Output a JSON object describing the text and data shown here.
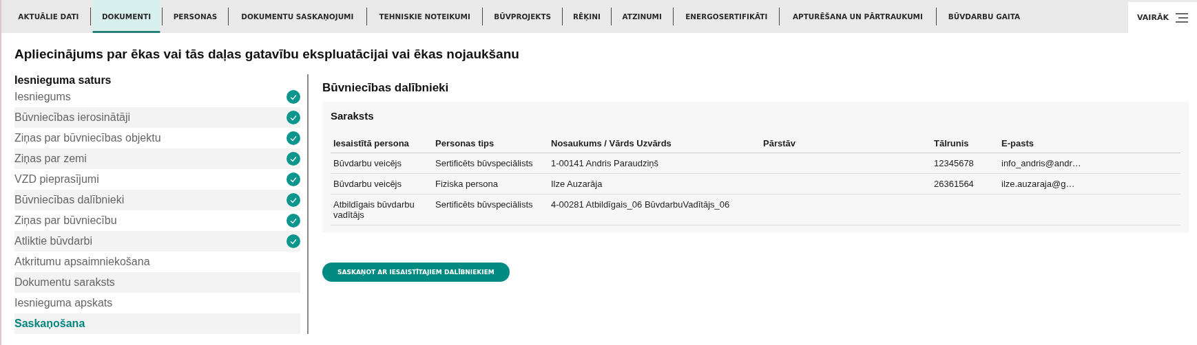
{
  "tabs": [
    {
      "label": "AKTUĀLIE DATI",
      "selected": false
    },
    {
      "label": "DOKUMENTI",
      "selected": true
    },
    {
      "label": "PERSONAS",
      "selected": false
    },
    {
      "label": "DOKUMENTU SASKAŅOJUMI",
      "selected": false
    },
    {
      "label": "TEHNISKIE NOTEIKUMI",
      "selected": false
    },
    {
      "label": "BŪVPROJEKTS",
      "selected": false
    },
    {
      "label": "RĒĶINI",
      "selected": false
    },
    {
      "label": "ATZINUMI",
      "selected": false
    },
    {
      "label": "ENERGOSERTIFIKĀTI",
      "selected": false
    },
    {
      "label": "APTURĒŠANA UN PĀRTRAUKUMI",
      "selected": false
    },
    {
      "label": "BŪVDARBU GAITA",
      "selected": false
    }
  ],
  "more_button": {
    "label": "VAIRĀK"
  },
  "page_title": "Apliecinājums par ēkas vai tās daļas gatavību ekspluatācijai vai ēkas nojaukšanu",
  "sidebar": {
    "heading": "Iesnieguma saturs",
    "items": [
      {
        "label": "Iesniegums",
        "checked": true,
        "selected": false
      },
      {
        "label": "Būvniecības ierosinātāji",
        "checked": true,
        "selected": false
      },
      {
        "label": "Ziņas par būvniecības objektu",
        "checked": true,
        "selected": false
      },
      {
        "label": "Ziņas par zemi",
        "checked": true,
        "selected": false
      },
      {
        "label": "VZD pieprasījumi",
        "checked": true,
        "selected": false
      },
      {
        "label": "Būvniecības dalībnieki",
        "checked": true,
        "selected": false
      },
      {
        "label": "Ziņas par būvniecību",
        "checked": true,
        "selected": false
      },
      {
        "label": "Atliktie būvdarbi",
        "checked": true,
        "selected": false
      },
      {
        "label": "Atkritumu apsaimniekošana",
        "checked": false,
        "selected": false
      },
      {
        "label": "Dokumentu saraksts",
        "checked": false,
        "selected": false
      },
      {
        "label": "Iesnieguma apskats",
        "checked": false,
        "selected": false
      },
      {
        "label": "Saskaņošana",
        "checked": false,
        "selected": true
      }
    ]
  },
  "section_title": "Būvniecības dalībnieki",
  "table": {
    "title": "Saraksts",
    "columns": [
      "Iesaistītā persona",
      "Personas tips",
      "Nosaukums / Vārds Uzvārds",
      "Pārstāv",
      "Tālrunis",
      "E-pasts"
    ],
    "rows": [
      [
        "Būvdarbu veicējs",
        "Sertificēts būvspeciālists",
        "1-00141 Andris Paraudziņš",
        "",
        "12345678",
        "info_andris@andr…"
      ],
      [
        "Būvdarbu veicējs",
        "Fiziska persona",
        "Ilze Auzarāja",
        "",
        "26361564",
        "ilze.auzaraja@g…"
      ],
      [
        "Atbildīgais būvdarbu vadītājs",
        "Sertificēts būvspeciālists",
        "4-00281 Atbildīgais_06 BūvdarbuVadītājs_06",
        "",
        "",
        ""
      ]
    ]
  },
  "action_button": {
    "label": "SASKAŅOT AR IESAISTĪTAJIEM DALĪBNIEKIEM"
  }
}
